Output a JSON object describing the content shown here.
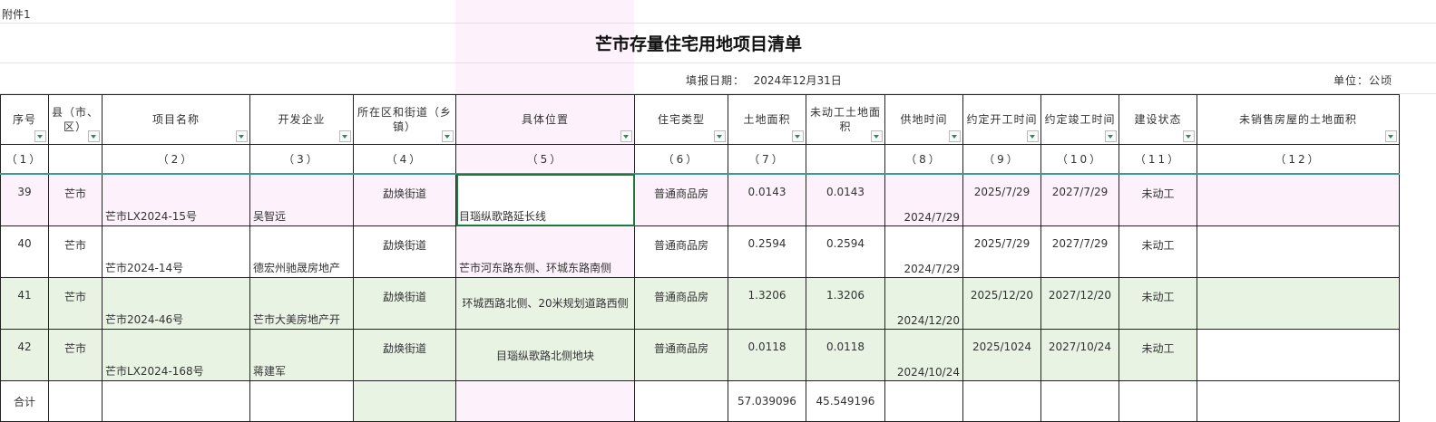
{
  "attachment": "附件1",
  "title": "芒市存量住宅用地项目清单",
  "fill_date_label": "填报日期：",
  "fill_date": "2024年12月31日",
  "unit": "单位：公顷",
  "headers": [
    "序号",
    "县（市、区）",
    "项目名称",
    "开发企业",
    "所在区和街道（乡镇）",
    "具体位置",
    "住宅类型",
    "土地面积",
    "未动工土地面积",
    "供地时间",
    "约定开工时间",
    "约定竣工时间",
    "建设状态",
    "未销售房屋的土地面积"
  ],
  "col_numbers": [
    "（1）",
    "",
    "（2）",
    "（3）",
    "（4）",
    "（5）",
    "（6）",
    "（7）",
    "",
    "（8）",
    "（9）",
    "（10）",
    "（11）",
    "（12）"
  ],
  "rows": [
    {
      "no": "39",
      "county": "芒市",
      "name": "芒市LX2024-15号",
      "dev": "吴智远",
      "street": "勐焕街道",
      "loc": "目瑙纵歌路延长线",
      "type": "普通商品房",
      "area": "0.0143",
      "unstarted": "0.0143",
      "supply": "2024/7/29",
      "start": "2025/7/29",
      "finish": "2027/7/29",
      "status": "未动工",
      "unsold": ""
    },
    {
      "no": "40",
      "county": "芒市",
      "name": "芒市2024-14号",
      "dev": "德宏州驰晟房地产",
      "street": "勐焕街道",
      "loc": "芒市河东路东侧、环城东路南侧",
      "type": "普通商品房",
      "area": "0.2594",
      "unstarted": "0.2594",
      "supply": "2024/7/29",
      "start": "2025/7/29",
      "finish": "2027/7/29",
      "status": "未动工",
      "unsold": ""
    },
    {
      "no": "41",
      "county": "芒市",
      "name": "芒市2024-46号",
      "dev": "芒市大美房地产开",
      "street": "勐焕街道",
      "loc": "环城西路北侧、20米规划道路西侧",
      "type": "普通商品房",
      "area": "1.3206",
      "unstarted": "1.3206",
      "supply": "2024/12/20",
      "start": "2025/12/20",
      "finish": "2027/12/20",
      "status": "未动工",
      "unsold": ""
    },
    {
      "no": "42",
      "county": "芒市",
      "name": "芒市LX2024-168号",
      "dev": "蒋建军",
      "street": "勐焕街道",
      "loc": "目瑙纵歌路北侧地块",
      "type": "普通商品房",
      "area": "0.0118",
      "unstarted": "0.0118",
      "supply": "2024/10/24",
      "start": "2025/1024",
      "finish": "2027/10/24",
      "status": "未动工",
      "unsold": ""
    }
  ],
  "total": {
    "label": "合计",
    "area": "57.039096",
    "unstarted": "45.549196"
  }
}
